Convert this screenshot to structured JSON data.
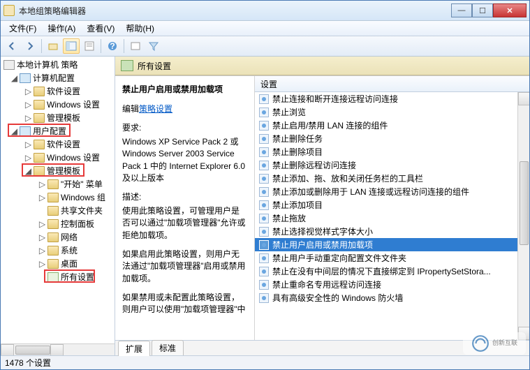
{
  "window": {
    "title": "本地组策略编辑器"
  },
  "menu": {
    "file": "文件(F)",
    "action": "操作(A)",
    "view": "查看(V)",
    "help": "帮助(H)"
  },
  "tree": {
    "root": "本地计算机 策略",
    "computer_cfg": "计算机配置",
    "cc_software": "软件设置",
    "cc_windows": "Windows 设置",
    "cc_admin": "管理模板",
    "user_cfg": "用户配置",
    "uc_software": "软件设置",
    "uc_windows": "Windows 设置",
    "uc_admin": "管理模板",
    "start_menu": "\"开始\" 菜单",
    "windows_comp": "Windows 组",
    "shared_folders": "共享文件夹",
    "control_panel": "控制面板",
    "network": "网络",
    "system": "系统",
    "desktop": "桌面",
    "all_settings": "所有设置"
  },
  "right": {
    "header": "所有设置",
    "column": "设置",
    "desc": {
      "title": "禁止用户启用或禁用加载项",
      "edit_prefix": "编辑",
      "edit_link": "策略设置",
      "req_label": "要求:",
      "req_text": "Windows XP Service Pack 2 或 Windows Server 2003 Service Pack 1 中的 Internet Explorer 6.0 及以上版本",
      "desc_label": "描述:",
      "desc_text1": "使用此策略设置，可管理用户是否可以通过\"加载项管理器\"允许或拒绝加载项。",
      "desc_text2": "如果启用此策略设置，则用户无法通过\"加载项管理器\"启用或禁用加载项。",
      "desc_text3": "如果禁用或未配置此策略设置，则用户可以使用\"加载项管理器\"中"
    },
    "items": [
      "禁止连接和断开连接远程访问连接",
      "禁止浏览",
      "禁止启用/禁用 LAN 连接的组件",
      "禁止删除任务",
      "禁止删除项目",
      "禁止删除远程访问连接",
      "禁止添加、拖、放和关闭任务栏的工具栏",
      "禁止添加或删除用于 LAN 连接或远程访问连接的组件",
      "禁止添加项目",
      "禁止拖放",
      "禁止选择视觉样式字体大小",
      "禁止用户启用或禁用加载项",
      "禁止用户手动重定向配置文件文件夹",
      "禁止在没有中间层的情况下直接绑定到 IPropertySetStora...",
      "禁止重命名专用远程访问连接",
      "具有高级安全性的 Windows 防火墙"
    ],
    "selected_index": 11
  },
  "tabs": {
    "extended": "扩展",
    "standard": "标准"
  },
  "status": "1478 个设置",
  "watermark": {
    "name": "创新互联"
  }
}
